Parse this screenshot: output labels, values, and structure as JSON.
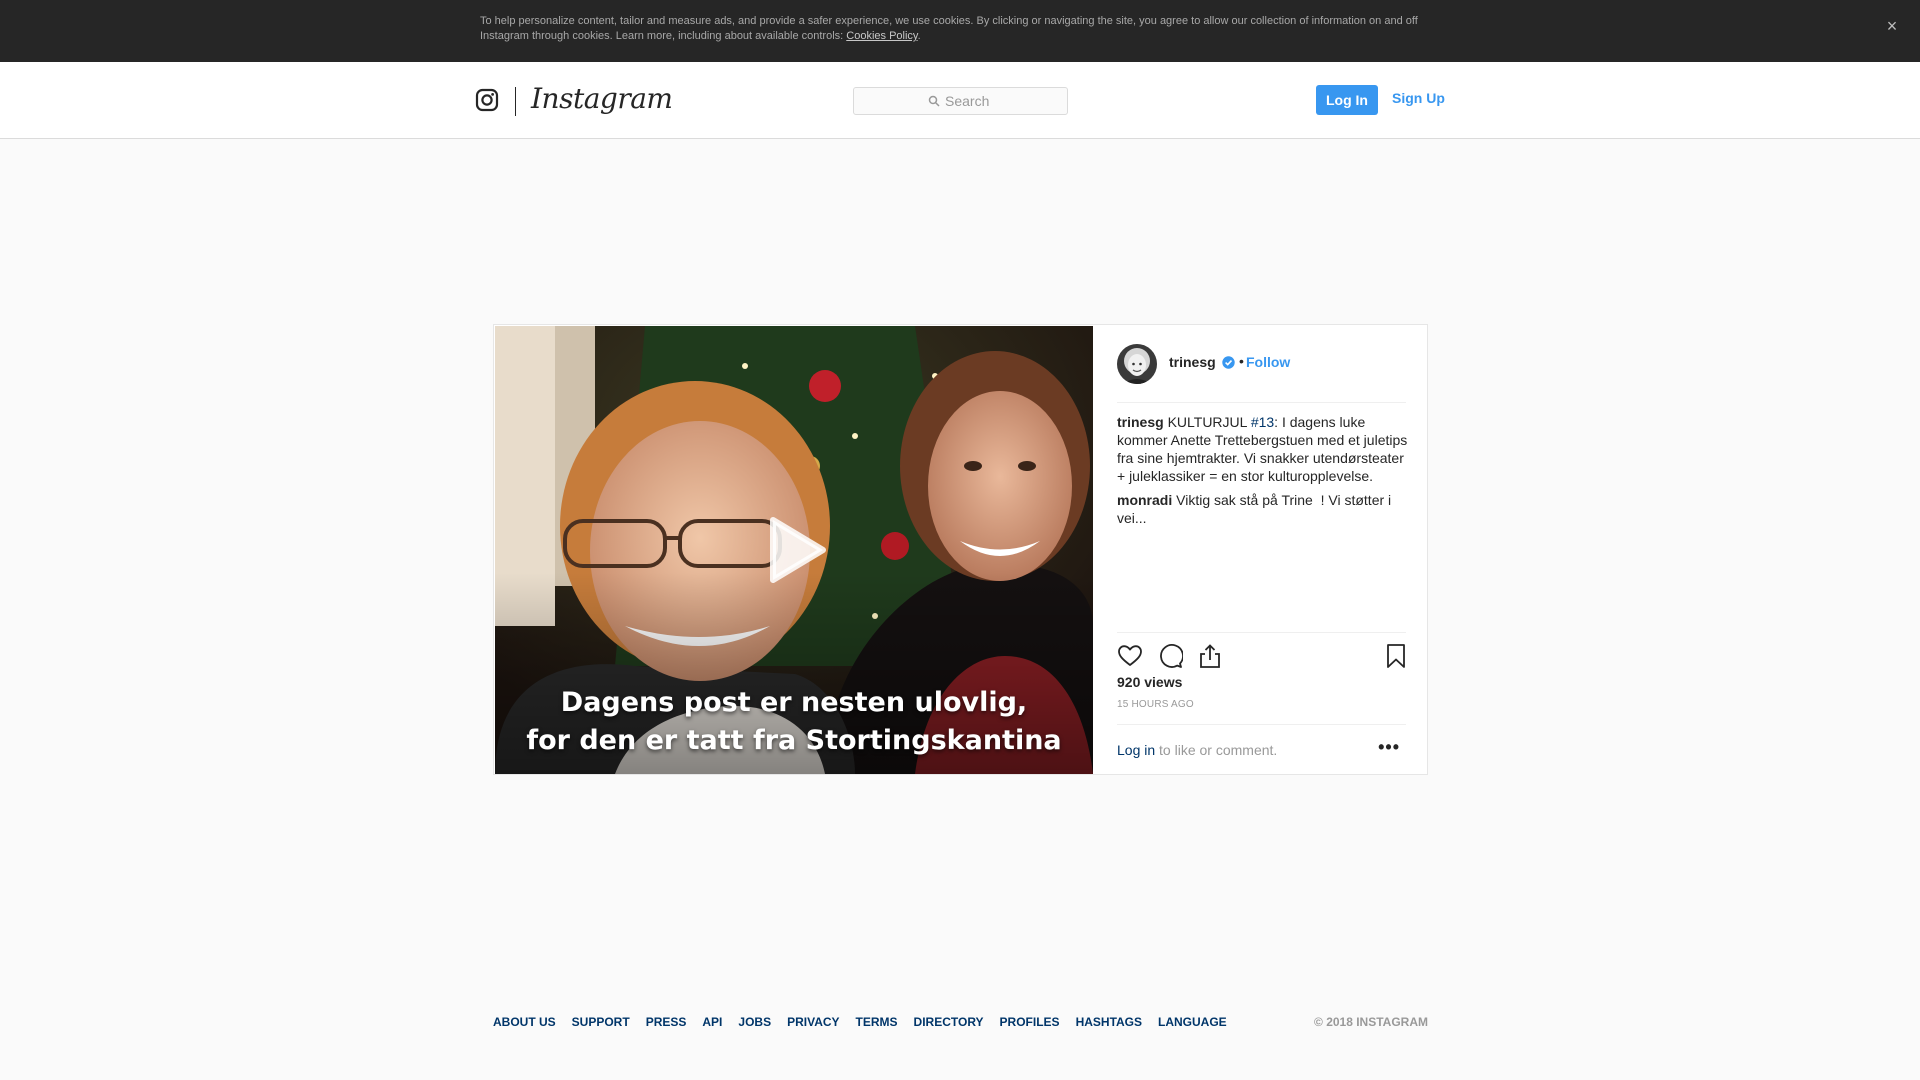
{
  "cookie_banner": {
    "text": "To help personalize content, tailor and measure ads, and provide a safer experience, we use cookies. By clicking or navigating the site, you agree to allow our collection of information on and off Instagram through cookies. Learn more, including about available controls: ",
    "link_label": "Cookies Policy",
    "end_punct": ".",
    "close_glyph": "×"
  },
  "header": {
    "brand": "Instagram",
    "search_placeholder": "Search",
    "login_label": "Log In",
    "signup_label": "Sign Up"
  },
  "post": {
    "overlay_lines": [
      "Dagens post er nesten ulovlig,",
      "for den er tatt fra Stortingskantina"
    ],
    "username": "trinesg",
    "separator": "•",
    "follow_label": "Follow",
    "caption": {
      "user": "trinesg",
      "before_tag": "KULTURJUL ",
      "tag": "#13",
      "after_tag": ": I dagens luke kommer Anette Trettebergstuen med et juletips fra sine hjemtrakter. Vi snakker utendørsteater + juleklassiker = en stor kulturopplevelse."
    },
    "comment": {
      "user": "monradi",
      "text": "Viktig sak stå på Trine⁠ ⁠ ! Vi støtter i vei..."
    },
    "views": "920 views",
    "time_ago": "15 HOURS AGO",
    "login_prompt": {
      "link": "Log in",
      "text": " to like or comment."
    },
    "more_glyph": "•••"
  },
  "footer": {
    "links": [
      "ABOUT US",
      "SUPPORT",
      "PRESS",
      "API",
      "JOBS",
      "PRIVACY",
      "TERMS",
      "DIRECTORY",
      "PROFILES",
      "HASHTAGS",
      "LANGUAGE"
    ],
    "copyright": "© 2018 INSTAGRAM"
  },
  "colors": {
    "accent": "#3897f0",
    "link_dark": "#003569",
    "banner_bg": "#262626",
    "page_bg": "#fafafa"
  },
  "icons": [
    "instagram-glyph-icon",
    "search-icon",
    "close-icon",
    "play-icon",
    "verified-badge-icon",
    "heart-icon",
    "comment-icon",
    "share-icon",
    "bookmark-icon",
    "more-options-icon"
  ]
}
